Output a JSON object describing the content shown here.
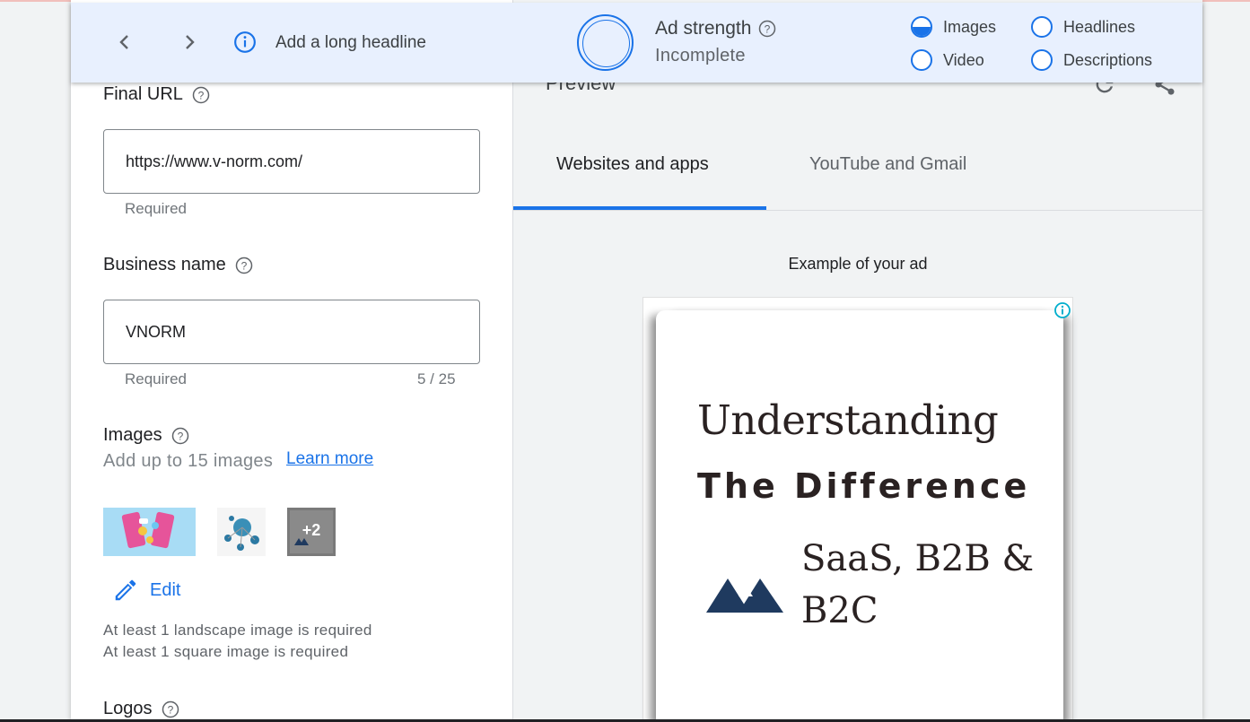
{
  "header": {
    "prev_label": "Previous",
    "next_label": "Next",
    "hint": "Add a long headline",
    "ad_strength_label": "Ad strength",
    "ad_strength_value": "Incomplete",
    "checklist": [
      {
        "label": "Images",
        "state": "half"
      },
      {
        "label": "Video",
        "state": "empty"
      },
      {
        "label": "Headlines",
        "state": "empty"
      },
      {
        "label": "Descriptions",
        "state": "empty"
      }
    ]
  },
  "form": {
    "final_url": {
      "label": "Final URL",
      "value": "https://www.v-norm.com/",
      "helper": "Required"
    },
    "business_name": {
      "label": "Business name",
      "value": "VNORM",
      "helper": "Required",
      "counter": "5 / 25"
    },
    "images": {
      "label": "Images",
      "subtitle": "Add up to 15 images",
      "learn_more": "Learn more",
      "more_count": "+2",
      "edit_label": "Edit",
      "requirements": [
        "At least 1 landscape image is required",
        "At least 1 square image is required"
      ]
    },
    "logos": {
      "label": "Logos"
    }
  },
  "preview": {
    "title": "Preview",
    "tabs": [
      "Websites and apps",
      "YouTube and Gmail"
    ],
    "active_tab": 0,
    "example_label": "Example of your ad",
    "ad": {
      "line1": "Understanding",
      "line2": "The Difference",
      "line3": "SaaS, B2B & B2C"
    }
  },
  "colors": {
    "accent": "#1a73e8",
    "header_bg": "#e8f0fe",
    "brand_dark": "#1f3a5f"
  }
}
